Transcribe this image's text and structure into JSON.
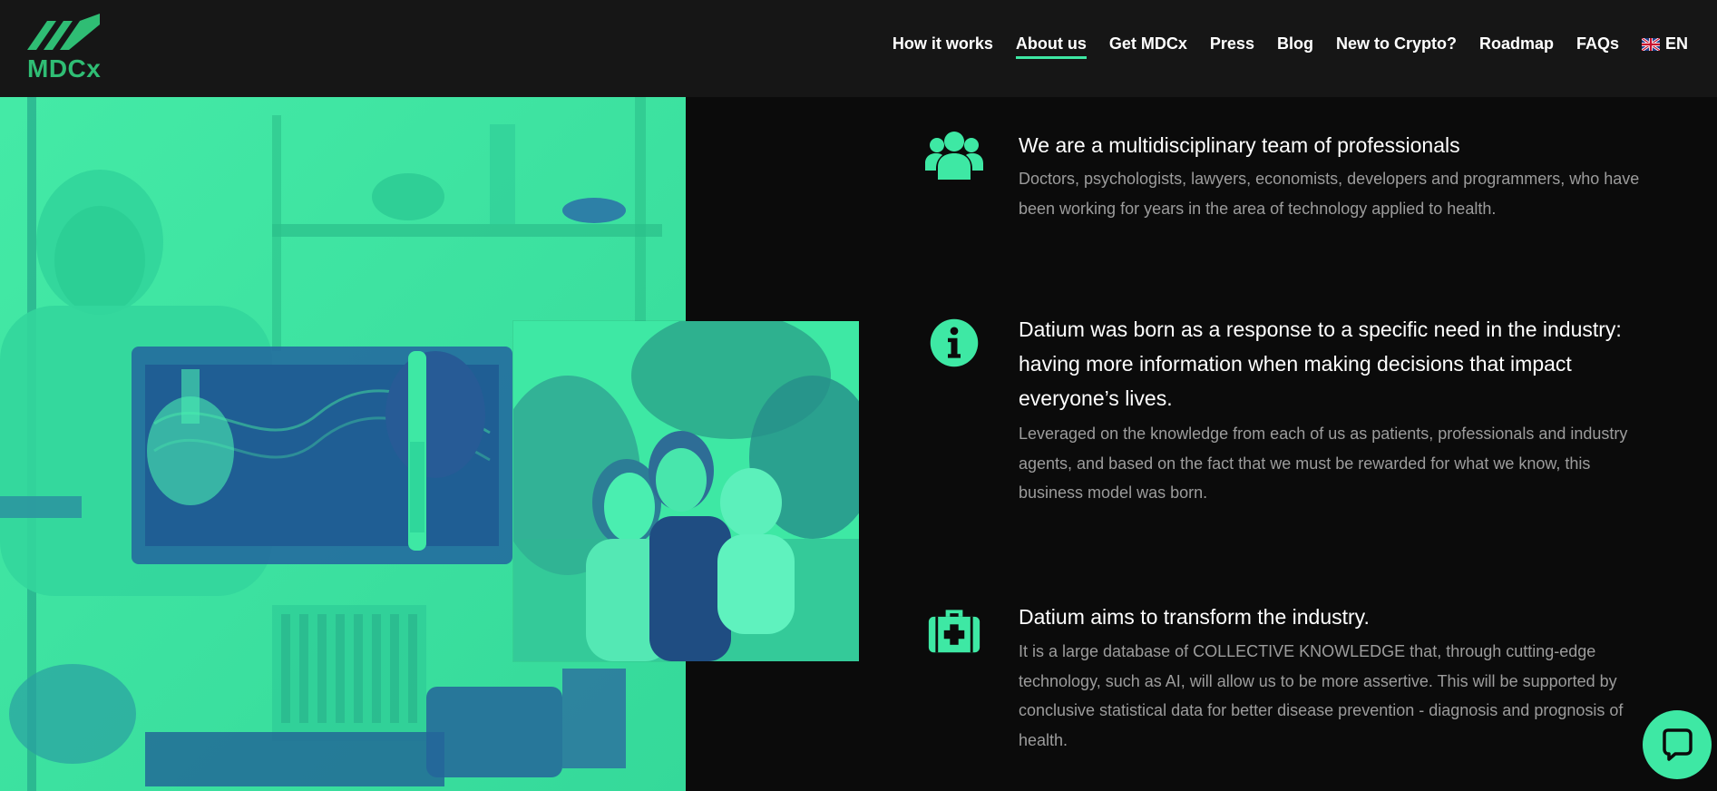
{
  "brand": {
    "logo_text": "MDCx",
    "accent": "#3ee8a4"
  },
  "nav": {
    "items": [
      {
        "label": "How it works"
      },
      {
        "label": "About us"
      },
      {
        "label": "Get MDCx"
      },
      {
        "label": "Press"
      },
      {
        "label": "Blog"
      },
      {
        "label": "New to Crypto?"
      },
      {
        "label": "Roadmap"
      },
      {
        "label": "FAQs"
      }
    ],
    "active_index": 1,
    "language": "EN"
  },
  "features": [
    {
      "icon": "team-icon",
      "title": "We are a multidisciplinary team of professionals",
      "text": "Doctors, psychologists, lawyers, economists, developers and programmers, who have been working for years in the area of technology applied to health."
    },
    {
      "icon": "info-icon",
      "title": "Datium was born as a response to a specific need in the industry: having more information when making decisions that impact everyone’s lives.",
      "text": "Leveraged on the knowledge from each of us as patients, professionals and industry agents, and based on the fact that we must be rewarded for what we know, this business model was born."
    },
    {
      "icon": "medical-kit-icon",
      "title": "Datium aims to transform the industry.",
      "text": "It is a large database of COLLECTIVE KNOWLEDGE that, through cutting-edge technology, such as AI, will allow us to be more assertive. This will be supported by conclusive statistical data for better disease prevention - diagnosis and prognosis of health."
    }
  ],
  "chat": {
    "icon": "chat-icon"
  }
}
